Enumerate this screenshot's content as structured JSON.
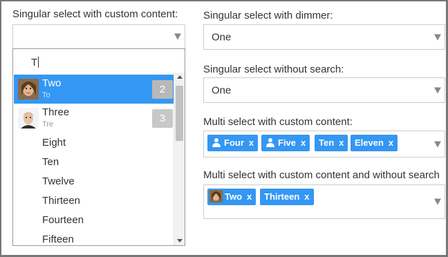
{
  "left": {
    "label": "Singular select with custom content:",
    "search_text": "T",
    "options": [
      {
        "label": "Two",
        "sub": "To",
        "count": "2",
        "active": true
      },
      {
        "label": "Three",
        "sub": "Tre",
        "count": "3",
        "active": false
      }
    ],
    "plain_options": [
      "Eight",
      "Ten",
      "Twelve",
      "Thirteen",
      "Fourteen",
      "Fifteen"
    ]
  },
  "dimmer": {
    "label": "Singular select with dimmer:",
    "value": "One"
  },
  "nosearch": {
    "label": "Singular select without search:",
    "value": "One"
  },
  "multi": {
    "label": "Multi select with custom content:",
    "tags": [
      {
        "label": "Four",
        "icon": "user-icon",
        "remove": "x"
      },
      {
        "label": "Five",
        "icon": "user-icon",
        "remove": "x"
      },
      {
        "label": "Ten",
        "remove": "x"
      },
      {
        "label": "Eleven",
        "remove": "x"
      }
    ]
  },
  "multi_nosearch": {
    "label": "Multi select with custom content and without search",
    "tags": [
      {
        "label": "Two",
        "icon": "avatar-two",
        "remove": "x"
      },
      {
        "label": "Thirteen",
        "remove": "x"
      }
    ]
  },
  "colors": {
    "accent": "#3497f3",
    "count_badge": "#c8c8c8",
    "border": "#cccccc"
  }
}
